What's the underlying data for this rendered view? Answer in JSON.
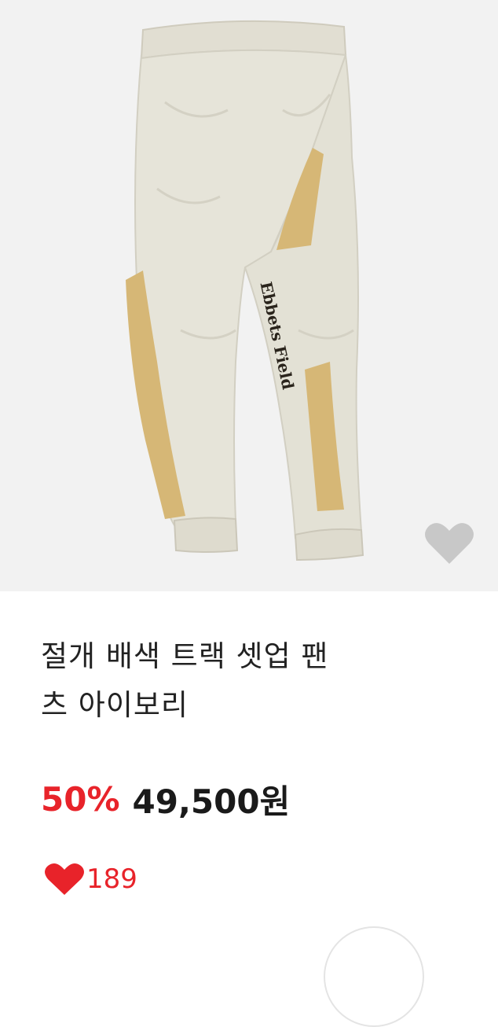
{
  "product": {
    "title_line1": "절개 배색 트랙 셋업 팬",
    "title_line2": "츠 아이보리",
    "discount": "50%",
    "price": "49,500원",
    "like_count": "189",
    "image_logo_text": "Ebbets Field"
  },
  "colors": {
    "discount": "#e8232a",
    "heart": "#e8232a",
    "pants_main": "#e4e2d6",
    "pants_panel": "#d6b776",
    "wish_icon": "#c8c8c8"
  },
  "icons": {
    "wish": "heart-icon",
    "like": "heart-icon"
  }
}
